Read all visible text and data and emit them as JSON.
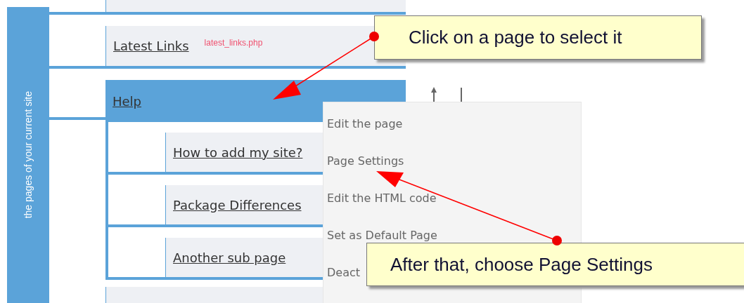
{
  "sidebar": {
    "label": "the pages of your current site"
  },
  "pages": [
    {
      "label": "Latest Links",
      "file": "latest_links.php",
      "selected": false
    },
    {
      "label": "Help",
      "selected": true,
      "expanded": true,
      "children": [
        {
          "label": "How to add my site?",
          "selected": false
        },
        {
          "label": "Package Differences",
          "selected": false
        },
        {
          "label": "Another sub page",
          "selected": false
        }
      ]
    }
  ],
  "context_menu": {
    "items": [
      "Edit the page",
      "Page Settings",
      "Edit the HTML code",
      "Set as Default Page",
      "Deact"
    ]
  },
  "callouts": [
    {
      "text": "Click on a page to select it"
    },
    {
      "text": "After that, choose Page Settings"
    }
  ]
}
